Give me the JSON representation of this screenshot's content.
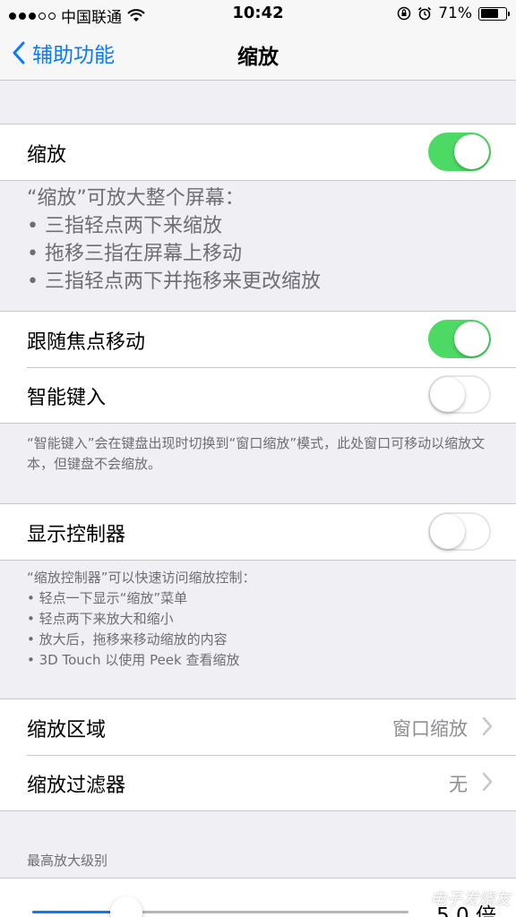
{
  "status": {
    "carrier": "中国联通",
    "time": "10:42",
    "battery": "71%",
    "battery_level": 0.71
  },
  "nav": {
    "back": "辅助功能",
    "title": "缩放"
  },
  "zoom": {
    "label": "缩放",
    "toggle": "on"
  },
  "zoom_desc": {
    "heading": "“缩放”可放大整个屏幕：",
    "items": [
      "• 三指轻点两下来缩放",
      "• 拖移三指在屏幕上移动",
      "• 三指轻点两下并拖移来更改缩放"
    ]
  },
  "follow_focus": {
    "label": "跟随焦点移动",
    "toggle": "on"
  },
  "smart_typing": {
    "label": "智能键入",
    "toggle": "off"
  },
  "smart_desc": "“智能键入”会在键盘出现时切换到“窗口缩放”模式，此处窗口可移动以缩放文本，但键盘不会缩放。",
  "controller": {
    "label": "显示控制器",
    "toggle": "off"
  },
  "controller_desc": {
    "heading": "“缩放控制器”可以快速访问缩放控制：",
    "items": [
      "• 轻点一下显示“缩放”菜单",
      "• 轻点两下来放大和缩小",
      "• 放大后，拖移来移动缩放的内容",
      "• 3D Touch 以使用 Peek 查看缩放"
    ]
  },
  "region": {
    "label": "缩放区域",
    "value": "窗口缩放"
  },
  "filter": {
    "label": "缩放过滤器",
    "value": "无"
  },
  "max_zoom": {
    "header": "最高放大级别",
    "value": "5.0 倍",
    "level_fraction": 0.25
  },
  "watermark": "电子发烧友",
  "colors": {
    "accent": "#0a7aff",
    "switch_on": "#4cd964",
    "background": "#efeff4"
  }
}
